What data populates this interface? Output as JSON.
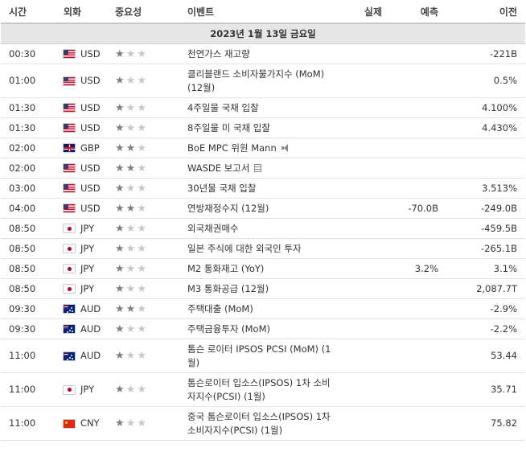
{
  "headers": {
    "time": "시간",
    "currency": "외화",
    "importance": "중요성",
    "event": "이벤트",
    "actual": "실제",
    "forecast": "예측",
    "previous": "이전"
  },
  "date_label": "2023년 1월 13일 금요일",
  "events": [
    {
      "time": "00:30",
      "currency": "USD",
      "flag": "us",
      "stars": "★☆☆",
      "event": "천연가스 재고량",
      "actual": "",
      "forecast": "",
      "previous": "-221B"
    },
    {
      "time": "01:00",
      "currency": "USD",
      "flag": "us",
      "stars": "★☆☆",
      "event": "클리블랜드 소비자물가지수 (MoM) (12월)",
      "actual": "",
      "forecast": "",
      "previous": "0.5%"
    },
    {
      "time": "01:30",
      "currency": "USD",
      "flag": "us",
      "stars": "★☆☆",
      "event": "4주일물 국채 입찰",
      "actual": "",
      "forecast": "",
      "previous": "4.100%"
    },
    {
      "time": "01:30",
      "currency": "USD",
      "flag": "us",
      "stars": "★☆☆",
      "event": "8주일물 미 국채 입찰",
      "actual": "",
      "forecast": "",
      "previous": "4.430%"
    },
    {
      "time": "02:00",
      "currency": "GBP",
      "flag": "gb",
      "stars": "★★☆",
      "event": "BoE MPC 위원 Mann",
      "icon": "speaker-icon",
      "actual": "",
      "forecast": "",
      "previous": ""
    },
    {
      "time": "02:00",
      "currency": "USD",
      "flag": "us",
      "stars": "★★☆",
      "event": "WASDE 보고서",
      "icon": "document-icon",
      "actual": "",
      "forecast": "",
      "previous": ""
    },
    {
      "time": "03:00",
      "currency": "USD",
      "flag": "us",
      "stars": "★☆☆",
      "event": "30년물 국채 입찰",
      "actual": "",
      "forecast": "",
      "previous": "3.513%"
    },
    {
      "time": "04:00",
      "currency": "USD",
      "flag": "us",
      "stars": "★★☆",
      "event": "연방재정수지 (12월)",
      "actual": "",
      "forecast": "-70.0B",
      "previous": "-249.0B"
    },
    {
      "time": "08:50",
      "currency": "JPY",
      "flag": "jp",
      "stars": "★☆☆",
      "event": "외국채권매수",
      "actual": "",
      "forecast": "",
      "previous": "-459.5B"
    },
    {
      "time": "08:50",
      "currency": "JPY",
      "flag": "jp",
      "stars": "★☆☆",
      "event": "일본 주식에 대한 외국인 투자",
      "actual": "",
      "forecast": "",
      "previous": "-265.1B"
    },
    {
      "time": "08:50",
      "currency": "JPY",
      "flag": "jp",
      "stars": "★☆☆",
      "event": "M2 통화재고 (YoY)",
      "actual": "",
      "forecast": "3.2%",
      "previous": "3.1%"
    },
    {
      "time": "08:50",
      "currency": "JPY",
      "flag": "jp",
      "stars": "★☆☆",
      "event": "M3 통화공급 (12월)",
      "actual": "",
      "forecast": "",
      "previous": "2,087.7T"
    },
    {
      "time": "09:30",
      "currency": "AUD",
      "flag": "au",
      "stars": "★★☆",
      "event": "주택대출 (MoM)",
      "actual": "",
      "forecast": "",
      "previous": "-2.9%"
    },
    {
      "time": "09:30",
      "currency": "AUD",
      "flag": "au",
      "stars": "★☆☆",
      "event": "주택금융투자 (MoM)",
      "actual": "",
      "forecast": "",
      "previous": "-2.2%"
    },
    {
      "time": "11:00",
      "currency": "AUD",
      "flag": "au",
      "stars": "★☆☆",
      "event": "톰슨 로이터 IPSOS PCSI (MoM) (1월)",
      "actual": "",
      "forecast": "",
      "previous": "53.44"
    },
    {
      "time": "11:00",
      "currency": "JPY",
      "flag": "jp",
      "stars": "★☆☆",
      "event": "톰슨로이터 입소스(IPSOS) 1차 소비자지수(PCSI) (1월)",
      "actual": "",
      "forecast": "",
      "previous": "35.71"
    },
    {
      "time": "11:00",
      "currency": "CNY",
      "flag": "cn",
      "stars": "★☆☆",
      "event": "중국 톰슨로이터 입소스(IPSOS) 1차 소비자지수(PCSI) (1월)",
      "actual": "",
      "forecast": "",
      "previous": "75.82"
    }
  ]
}
